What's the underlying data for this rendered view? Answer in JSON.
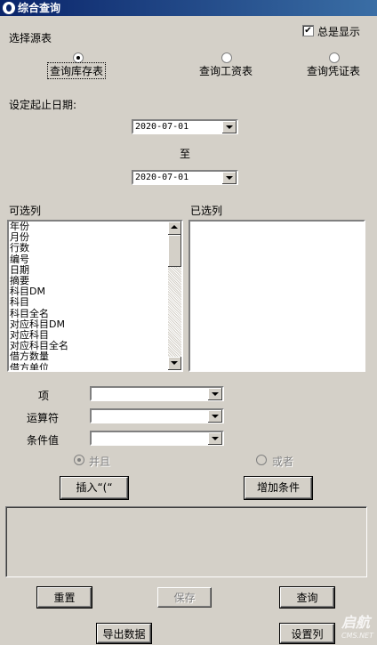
{
  "window": {
    "title": "综合查询"
  },
  "source": {
    "label": "选择源表",
    "always_show": {
      "label": "总是显示",
      "checked": true
    },
    "options": [
      {
        "label": "查询库存表",
        "selected": true
      },
      {
        "label": "查询工资表",
        "selected": false
      },
      {
        "label": "查询凭证表",
        "selected": false
      }
    ]
  },
  "dates": {
    "label": "设定起止日期:",
    "start": "2020-07-01",
    "to_label": "至",
    "end": "2020-07-01"
  },
  "columns": {
    "available_label": "可选列",
    "selected_label": "已选列",
    "available_items": [
      "年份",
      "月份",
      "行数",
      "编号",
      "日期",
      "摘要",
      "科目DM",
      "科目",
      "科目全名",
      "对应科目DM",
      "对应科目",
      "对应科目全名",
      "借方数量",
      "借方单位"
    ],
    "selected_items": []
  },
  "condition": {
    "item_label": "项",
    "operator_label": "运算符",
    "value_label": "条件值",
    "and_label": "并且",
    "or_label": "或者",
    "insert_button": "插入“(“",
    "add_button": "增加条件"
  },
  "actions": {
    "reset": "重置",
    "save": "保存",
    "query": "查询",
    "export": "导出数据",
    "set_columns": "设置列"
  },
  "watermark": {
    "text": "启航",
    "sub": "CMS.NET"
  }
}
